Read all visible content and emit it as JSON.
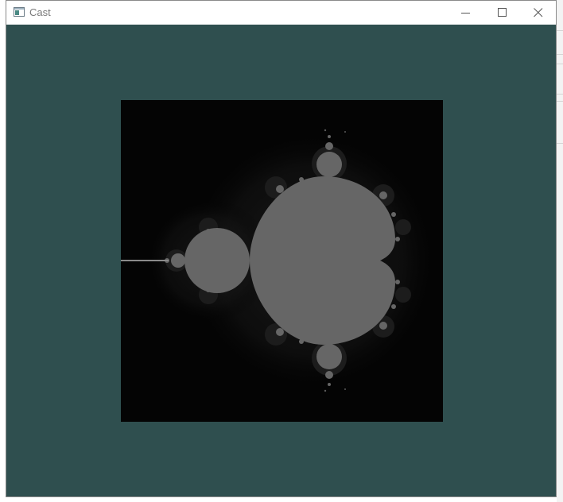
{
  "window": {
    "title": "Cast",
    "icon": "app-window-icon"
  },
  "titlebar_buttons": {
    "minimize": "minimize-icon",
    "maximize": "maximize-icon",
    "close": "close-icon"
  },
  "colors": {
    "client_background": "#2f4f4f",
    "canvas_background": "#000000",
    "set_fill": "#666666"
  },
  "canvas": {
    "content": "mandelbrot-set-render"
  }
}
